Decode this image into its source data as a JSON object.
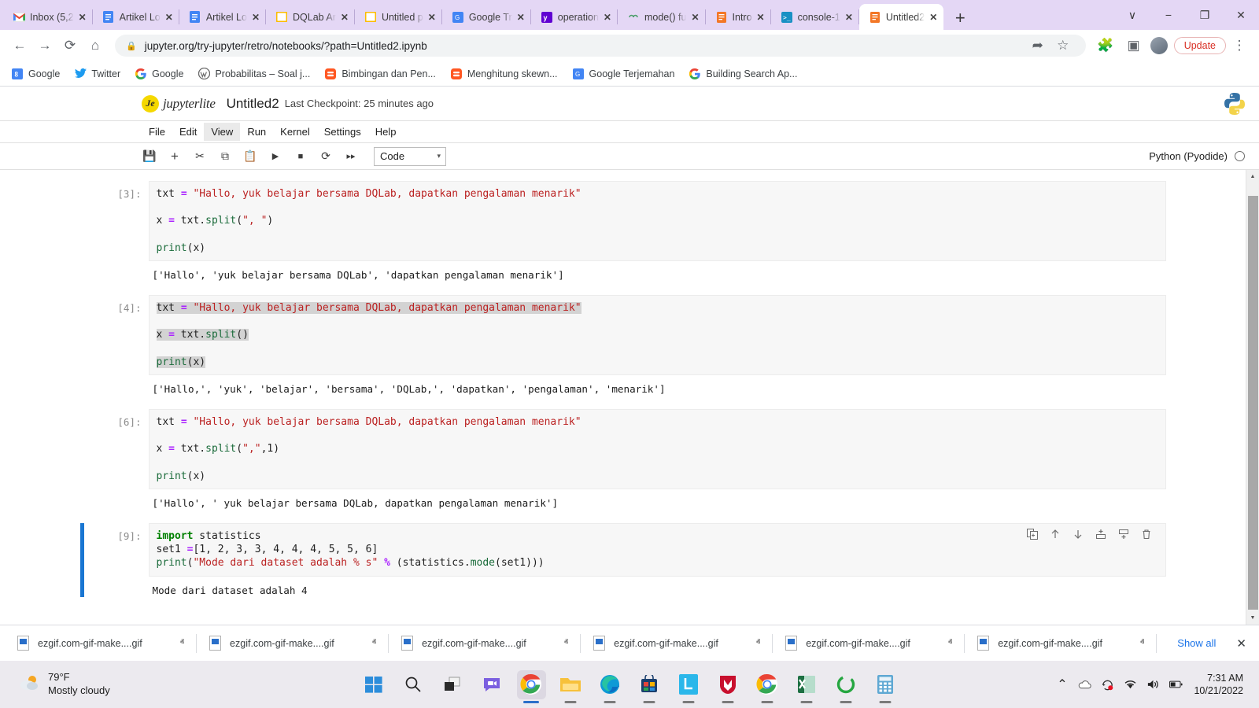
{
  "browser": {
    "tabs": [
      {
        "title": "Inbox (5,2",
        "icon": "gmail-icon",
        "active": false
      },
      {
        "title": "Artikel Lo",
        "icon": "docs-icon",
        "active": false
      },
      {
        "title": "Artikel Lo",
        "icon": "docs-icon",
        "active": false
      },
      {
        "title": "DQLab Ar",
        "icon": "window-icon",
        "active": false
      },
      {
        "title": "Untitled p",
        "icon": "window-icon",
        "active": false
      },
      {
        "title": "Google Tr",
        "icon": "translate-icon",
        "active": false
      },
      {
        "title": "operation",
        "icon": "yahoo-icon",
        "active": false
      },
      {
        "title": "mode() fu",
        "icon": "link-icon",
        "active": false
      },
      {
        "title": "Intro",
        "icon": "jupyter-icon",
        "active": false
      },
      {
        "title": "console-1",
        "icon": "terminal-icon",
        "active": false
      },
      {
        "title": "Untitled2",
        "icon": "jupyter-icon",
        "active": true
      }
    ],
    "new_tab_label": "+",
    "close_label": "✕",
    "window_controls": [
      "∨",
      "−",
      "❐",
      "✕"
    ],
    "nav": {
      "back": "←",
      "forward": "→",
      "reload": "⟳",
      "home": "⌂",
      "lock_icon": "lock-icon",
      "url": "jupyter.org/try-jupyter/retro/notebooks/?path=Untitled2.ipynb",
      "share_icon": "share-icon",
      "star_icon": "star-icon",
      "extensions_icon": "puzzle-icon",
      "sidepanel_icon": "side-panel-icon",
      "profile_icon": "avatar",
      "update_label": "Update",
      "menu_icon": "kebab-menu-icon"
    },
    "bookmarks": [
      {
        "label": "Google",
        "icon": "google-blue-icon"
      },
      {
        "label": "Twitter",
        "icon": "twitter-icon"
      },
      {
        "label": "Google",
        "icon": "google-icon"
      },
      {
        "label": "Probabilitas – Soal j...",
        "icon": "wordpress-icon"
      },
      {
        "label": "Bimbingan dan Pen...",
        "icon": "blogger-icon"
      },
      {
        "label": "Menghitung skewn...",
        "icon": "blogger-icon"
      },
      {
        "label": "Google Terjemahan",
        "icon": "translate-icon"
      },
      {
        "label": "Building Search Ap...",
        "icon": "google-icon"
      }
    ]
  },
  "jupyter": {
    "brand": "jupyterlite",
    "brand_initial": "Je",
    "notebook_title": "Untitled2",
    "checkpoint": "Last Checkpoint: 25 minutes ago",
    "python_logo": "python-logo-icon",
    "menus": [
      "File",
      "Edit",
      "View",
      "Run",
      "Kernel",
      "Settings",
      "Help"
    ],
    "selected_menu": "View",
    "toolbar_buttons": [
      {
        "name": "save-button",
        "glyph": "Ὃe"
      },
      {
        "name": "insert-cell-button",
        "glyph": "+"
      },
      {
        "name": "cut-button",
        "glyph": "✂"
      },
      {
        "name": "copy-button",
        "glyph": "⧉"
      },
      {
        "name": "paste-button",
        "glyph": "Ὄb"
      },
      {
        "name": "run-button",
        "glyph": "▶"
      },
      {
        "name": "stop-button",
        "glyph": "■"
      },
      {
        "name": "restart-button",
        "glyph": "⟳"
      },
      {
        "name": "restart-run-all-button",
        "glyph": "⏩"
      }
    ],
    "cell_type": "Code",
    "cell_type_chevron": "▾",
    "kernel_name": "Python (Pyodide)",
    "cells": [
      {
        "prompt": "[3]:",
        "selected": false,
        "running_marker": false,
        "lines": [
          [
            {
              "t": "txt ",
              "c": ""
            },
            {
              "t": "=",
              "c": "s-op"
            },
            {
              "t": " ",
              "c": ""
            },
            {
              "t": "\"Hallo, yuk belajar bersama DQLab, dapatkan pengalaman menarik\"",
              "c": "s-str"
            }
          ],
          [],
          [
            {
              "t": "x ",
              "c": ""
            },
            {
              "t": "=",
              "c": "s-op"
            },
            {
              "t": " txt.",
              "c": ""
            },
            {
              "t": "split",
              "c": "s-fn"
            },
            {
              "t": "(",
              "c": ""
            },
            {
              "t": "\", \"",
              "c": "s-str"
            },
            {
              "t": ")",
              "c": ""
            }
          ],
          [],
          [
            {
              "t": "print",
              "c": "s-fn"
            },
            {
              "t": "(x)",
              "c": ""
            }
          ]
        ],
        "output": "['Hallo', 'yuk belajar bersama DQLab', 'dapatkan pengalaman menarik']"
      },
      {
        "prompt": "[4]:",
        "selected": true,
        "running_marker": false,
        "lines": [
          [
            {
              "t": "txt ",
              "c": "sel-hl"
            },
            {
              "t": "=",
              "c": "s-op sel-hl"
            },
            {
              "t": " ",
              "c": "sel-hl"
            },
            {
              "t": "\"Hallo, yuk belajar bersama DQLab, dapatkan pengalaman menarik\"",
              "c": "s-str sel-hl"
            }
          ],
          [],
          [
            {
              "t": "x ",
              "c": "sel-hl"
            },
            {
              "t": "=",
              "c": "s-op sel-hl"
            },
            {
              "t": " txt.",
              "c": "sel-hl"
            },
            {
              "t": "split",
              "c": "s-fn sel-hl"
            },
            {
              "t": "()",
              "c": "sel-hl"
            }
          ],
          [],
          [
            {
              "t": "print",
              "c": "s-fn sel-hl"
            },
            {
              "t": "(x)",
              "c": "sel-hl"
            }
          ]
        ],
        "output": "['Hallo,', 'yuk', 'belajar', 'bersama', 'DQLab,', 'dapatkan', 'pengalaman', 'menarik']"
      },
      {
        "prompt": "[6]:",
        "selected": false,
        "running_marker": false,
        "lines": [
          [
            {
              "t": "txt ",
              "c": ""
            },
            {
              "t": "=",
              "c": "s-op"
            },
            {
              "t": " ",
              "c": ""
            },
            {
              "t": "\"Hallo, yuk belajar bersama DQLab, dapatkan pengalaman menarik\"",
              "c": "s-str"
            }
          ],
          [],
          [
            {
              "t": "x ",
              "c": ""
            },
            {
              "t": "=",
              "c": "s-op"
            },
            {
              "t": " txt.",
              "c": ""
            },
            {
              "t": "split",
              "c": "s-fn"
            },
            {
              "t": "(",
              "c": ""
            },
            {
              "t": "\",\"",
              "c": "s-str"
            },
            {
              "t": ",",
              "c": ""
            },
            {
              "t": "1",
              "c": "s-num"
            },
            {
              "t": ")",
              "c": ""
            }
          ],
          [],
          [
            {
              "t": "print",
              "c": "s-fn"
            },
            {
              "t": "(x)",
              "c": ""
            }
          ]
        ],
        "output": "['Hallo', ' yuk belajar bersama DQLab, dapatkan pengalaman menarik']"
      },
      {
        "prompt": "[9]:",
        "selected": false,
        "running_marker": true,
        "show_tools": true,
        "lines": [
          [
            {
              "t": "import",
              "c": "s-kw"
            },
            {
              "t": " statistics",
              "c": ""
            }
          ],
          [
            {
              "t": "set1 ",
              "c": ""
            },
            {
              "t": "=",
              "c": "s-op"
            },
            {
              "t": "[",
              "c": ""
            },
            {
              "t": "1",
              "c": "s-num"
            },
            {
              "t": ", ",
              "c": ""
            },
            {
              "t": "2",
              "c": "s-num"
            },
            {
              "t": ", ",
              "c": ""
            },
            {
              "t": "3",
              "c": "s-num"
            },
            {
              "t": ", ",
              "c": ""
            },
            {
              "t": "3",
              "c": "s-num"
            },
            {
              "t": ", ",
              "c": ""
            },
            {
              "t": "4",
              "c": "s-num"
            },
            {
              "t": ", ",
              "c": ""
            },
            {
              "t": "4",
              "c": "s-num"
            },
            {
              "t": ", ",
              "c": ""
            },
            {
              "t": "4",
              "c": "s-num"
            },
            {
              "t": ", ",
              "c": ""
            },
            {
              "t": "5",
              "c": "s-num"
            },
            {
              "t": ", ",
              "c": ""
            },
            {
              "t": "5",
              "c": "s-num"
            },
            {
              "t": ", ",
              "c": ""
            },
            {
              "t": "6",
              "c": "s-num"
            },
            {
              "t": "]",
              "c": ""
            }
          ],
          [
            {
              "t": "print",
              "c": "s-fn"
            },
            {
              "t": "(",
              "c": ""
            },
            {
              "t": "\"Mode dari dataset adalah % s\"",
              "c": "s-str"
            },
            {
              "t": " ",
              "c": ""
            },
            {
              "t": "%",
              "c": "s-op"
            },
            {
              "t": " (statistics.",
              "c": ""
            },
            {
              "t": "mode",
              "c": "s-fn"
            },
            {
              "t": "(set1)))",
              "c": ""
            }
          ]
        ],
        "output": "Mode dari dataset adalah 4"
      }
    ],
    "cell_tools": [
      {
        "name": "duplicate-cell-icon",
        "glyph": "⧉"
      },
      {
        "name": "move-cell-up-icon",
        "glyph": "↑"
      },
      {
        "name": "move-cell-down-icon",
        "glyph": "↓"
      },
      {
        "name": "insert-cell-above-icon",
        "glyph": "⤓"
      },
      {
        "name": "insert-cell-below-icon",
        "glyph": "⤒"
      },
      {
        "name": "delete-cell-icon",
        "glyph": "Ὕ1"
      }
    ],
    "scrollbar": {
      "up_arrow": "▲",
      "down_arrow": "▼"
    }
  },
  "downloads": {
    "items": [
      {
        "name": "ezgif.com-gif-make....gif",
        "chevron": "ⱏ"
      },
      {
        "name": "ezgif.com-gif-make....gif",
        "chevron": "ⱏ"
      },
      {
        "name": "ezgif.com-gif-make....gif",
        "chevron": "ⱏ"
      },
      {
        "name": "ezgif.com-gif-make....gif",
        "chevron": "ⱏ"
      },
      {
        "name": "ezgif.com-gif-make....gif",
        "chevron": "ⱏ"
      },
      {
        "name": "ezgif.com-gif-make....gif",
        "chevron": "ⱏ"
      }
    ],
    "show_all_label": "Show all",
    "close_label": "✕"
  },
  "taskbar": {
    "weather": {
      "temperature": "79°F",
      "description": "Mostly cloudy",
      "icon": "partly-cloudy-icon"
    },
    "apps": [
      {
        "name": "start-button",
        "icon": "windows-logo-icon"
      },
      {
        "name": "search-button",
        "icon": "search-icon"
      },
      {
        "name": "task-view-button",
        "icon": "task-view-icon"
      },
      {
        "name": "chat-button",
        "icon": "chat-icon"
      },
      {
        "name": "chrome-button",
        "icon": "chrome-icon"
      },
      {
        "name": "file-explorer-button",
        "icon": "folder-icon"
      },
      {
        "name": "edge-button",
        "icon": "edge-icon"
      },
      {
        "name": "microsoft-store-button",
        "icon": "store-icon"
      },
      {
        "name": "app-l-button",
        "icon": "letter-l-icon"
      },
      {
        "name": "mcafee-button",
        "icon": "shield-icon"
      },
      {
        "name": "chrome-second-button",
        "icon": "chrome-icon"
      },
      {
        "name": "excel-button",
        "icon": "excel-icon"
      },
      {
        "name": "ring-app-button",
        "icon": "ring-icon"
      },
      {
        "name": "calculator-button",
        "icon": "calculator-icon"
      }
    ],
    "tray": [
      {
        "name": "show-hidden-icons",
        "glyph": "ⱏ"
      },
      {
        "name": "onedrive-icon",
        "glyph": "☁"
      },
      {
        "name": "update-notification-icon",
        "glyph": "⟳"
      },
      {
        "name": "wifi-icon",
        "glyph": "wifi"
      },
      {
        "name": "volume-icon",
        "glyph": "ὐa"
      },
      {
        "name": "battery-icon",
        "glyph": "battery"
      }
    ],
    "clock": {
      "time": "7:31 AM",
      "date": "10/21/2022"
    }
  },
  "colors": {
    "tabstrip_bg": "#e4d7f5",
    "accent_blue": "#1976d2",
    "link_blue": "#1a73e8",
    "update_red": "#d93025",
    "string_red": "#bb2222",
    "operator_purple": "#aa22ff",
    "function_green": "#1a6b3a"
  }
}
